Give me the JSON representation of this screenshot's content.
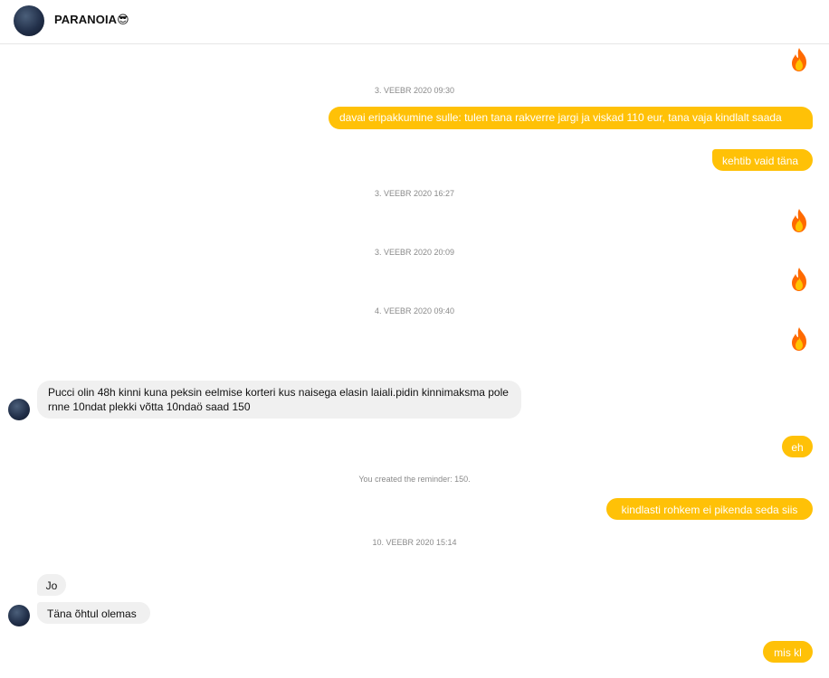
{
  "header": {
    "title": "PARANOIA😎"
  },
  "separators": [
    "3. VEEBR 2020 09:30",
    "3. VEEBR 2020 16:27",
    "3. VEEBR 2020 20:09",
    "4. VEEBR 2020 09:40",
    "You created the reminder: 150.",
    "10. VEEBR 2020 15:14"
  ],
  "messages": {
    "m1": "davai eripakkumine sulle: tulen tana rakverre jargi ja viskad 110 eur, tana vaja kindlalt saada",
    "m2": "kehtib vaid täna",
    "m3": "Pucci olin 48h kinni kuna peksin eelmise korteri kus naisega elasin laiali.pidin kinnimaksma pole rnne 10ndat plekki võtta 10ndaö saad 150",
    "m4": "eh",
    "m5": "kindlasti rohkem ei pikenda seda siis",
    "m6": "Jo",
    "m7": "Täna õhtul olemas",
    "m8": "mis kl"
  },
  "reactions": {
    "fire": "fire-emoji-icon"
  },
  "colors": {
    "outgoing": "#ffc107",
    "incoming": "#f0f0f0"
  }
}
